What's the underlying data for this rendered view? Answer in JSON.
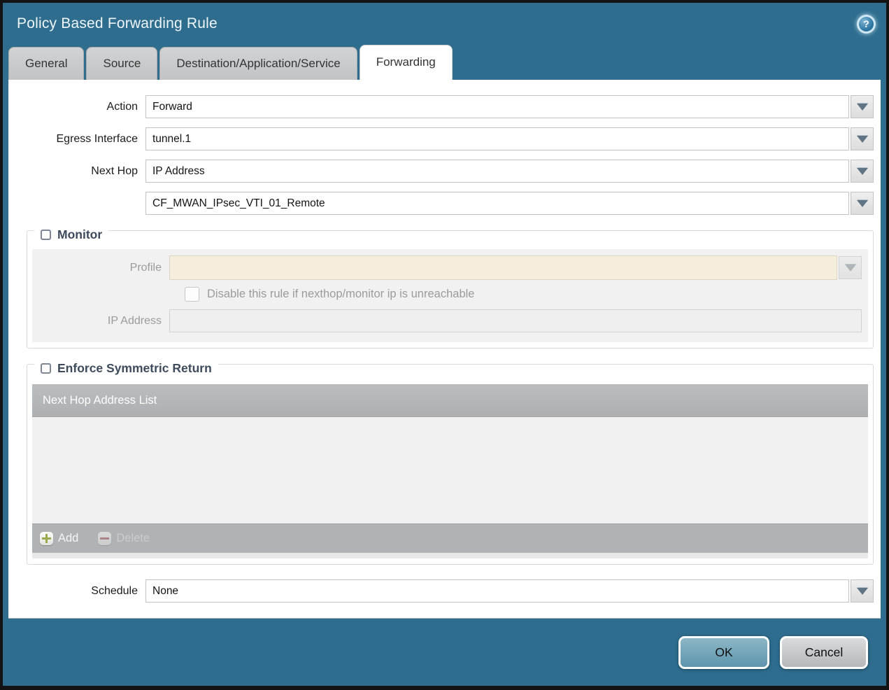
{
  "window": {
    "title": "Policy Based Forwarding Rule",
    "help_glyph": "?"
  },
  "tabs": [
    {
      "label": "General",
      "active": false
    },
    {
      "label": "Source",
      "active": false
    },
    {
      "label": "Destination/Application/Service",
      "active": false
    },
    {
      "label": "Forwarding",
      "active": true
    }
  ],
  "form": {
    "action": {
      "label": "Action",
      "value": "Forward"
    },
    "egress_interface": {
      "label": "Egress Interface",
      "value": "tunnel.1"
    },
    "next_hop": {
      "label": "Next Hop",
      "value": "IP Address"
    },
    "next_hop_address": {
      "value": "CF_MWAN_IPsec_VTI_01_Remote"
    },
    "schedule": {
      "label": "Schedule",
      "value": "None"
    }
  },
  "monitor": {
    "legend": "Monitor",
    "checked": false,
    "profile": {
      "label": "Profile",
      "value": ""
    },
    "disable_rule": {
      "label": "Disable this rule if nexthop/monitor ip is unreachable",
      "checked": false
    },
    "ip_address": {
      "label": "IP Address",
      "value": ""
    }
  },
  "enforce_symmetric_return": {
    "legend": "Enforce Symmetric Return",
    "checked": false,
    "table": {
      "header": "Next Hop Address List",
      "rows": []
    },
    "toolbar": {
      "add_label": "Add",
      "delete_label": "Delete",
      "delete_enabled": false
    }
  },
  "footer": {
    "ok_label": "OK",
    "cancel_label": "Cancel"
  },
  "colors": {
    "titlebar_teal": "#2e6d8e",
    "inactive_tab_bg": "#c6c7c8",
    "active_tab_bg": "#ffffff",
    "profile_field_bg": "#f6eedc",
    "table_header_bg": "#b3b6b8",
    "ok_button_bg": "#6fa5ba",
    "cancel_button_bg": "#c8c9ca",
    "add_icon_green": "#9aa949",
    "delete_icon_red": "#a85f66",
    "legend_text": "#3e4b5c"
  }
}
